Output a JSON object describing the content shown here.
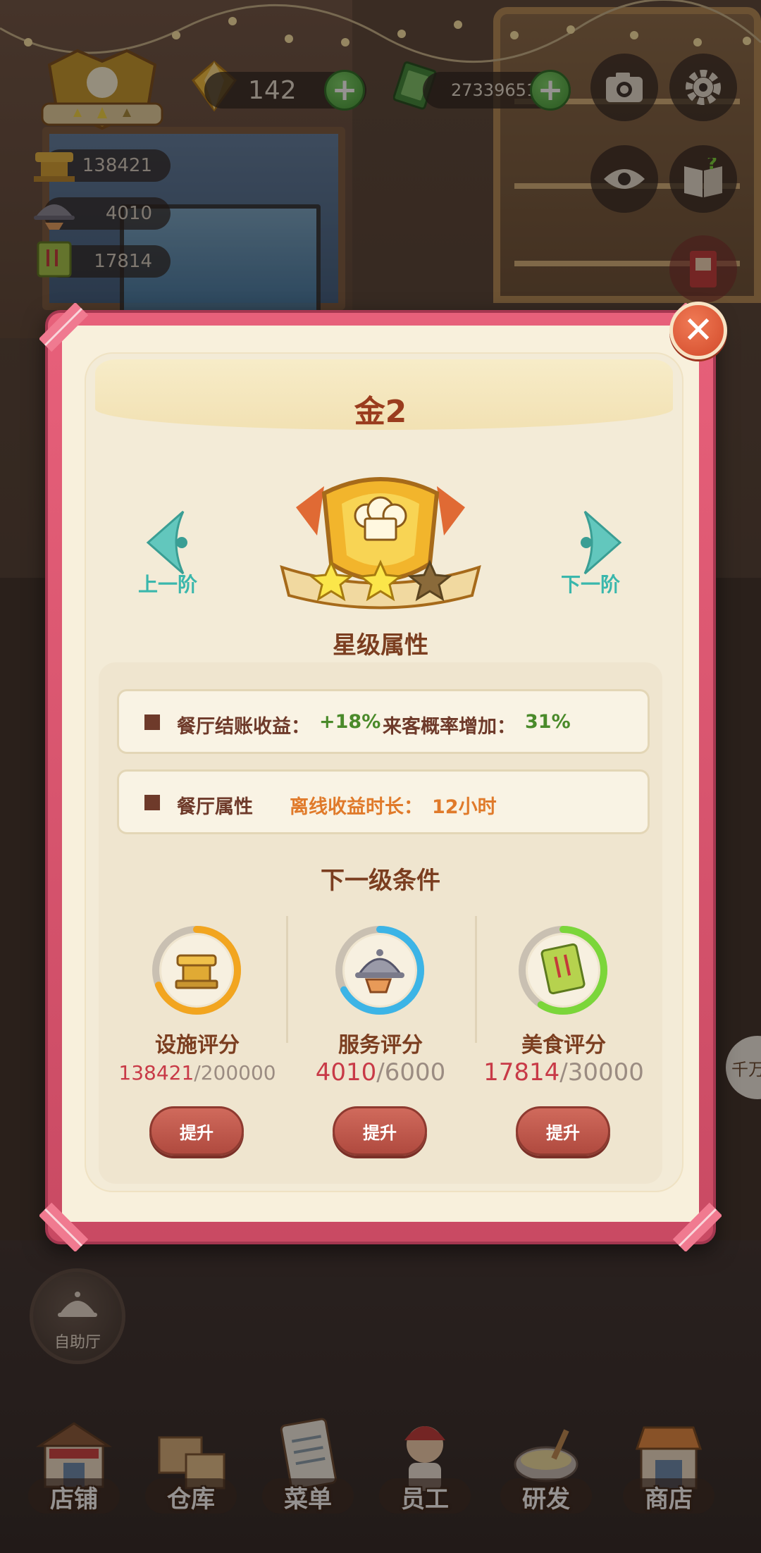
{
  "hud": {
    "gems": "142",
    "cash": "27339651",
    "facility_score": "138421",
    "service_score": "4010",
    "food_score": "17814"
  },
  "modal": {
    "rank_title": "金2",
    "prev_label": "上一阶",
    "next_label": "下一阶",
    "star_section_title": "星级属性",
    "attr_row1": {
      "label": "餐厅结账收益：",
      "value": "+18%",
      "label2": "来客概率增加：",
      "value2": "31%"
    },
    "attr_row2": {
      "label": "餐厅属性",
      "label2": "离线收益时长：",
      "value2": "12小时"
    },
    "next_level_title": "下一级条件",
    "requirements": [
      {
        "label": "设施评分",
        "current": "138421",
        "total": "/200000",
        "progress": 0.69,
        "ring_color": "#f2a51f",
        "button": "提升"
      },
      {
        "label": "服务评分",
        "current": "4010",
        "total": "/6000",
        "progress": 0.67,
        "ring_color": "#3cb4e6",
        "button": "提升"
      },
      {
        "label": "美食评分",
        "current": "17814",
        "total": "/30000",
        "progress": 0.59,
        "ring_color": "#7bd63a",
        "button": "提升"
      }
    ],
    "stars_filled": 2,
    "stars_total": 3
  },
  "buffet_label": "自助厅",
  "side_bubble": "千万",
  "nav": [
    {
      "label": "店铺",
      "icon": "shop-building-icon"
    },
    {
      "label": "仓库",
      "icon": "warehouse-boxes-icon"
    },
    {
      "label": "菜单",
      "icon": "menu-clipboard-icon"
    },
    {
      "label": "员工",
      "icon": "staff-chef-icon"
    },
    {
      "label": "研发",
      "icon": "research-pot-icon"
    },
    {
      "label": "商店",
      "icon": "store-stall-icon"
    }
  ],
  "colors": {
    "frame": "#d9536c",
    "paper": "#f3ebd7",
    "title": "#9a3c1e",
    "teal": "#3ab7ac",
    "green_value": "#4a8a2a",
    "orange_value": "#e07a2a",
    "button_red": "#b04a3f"
  }
}
